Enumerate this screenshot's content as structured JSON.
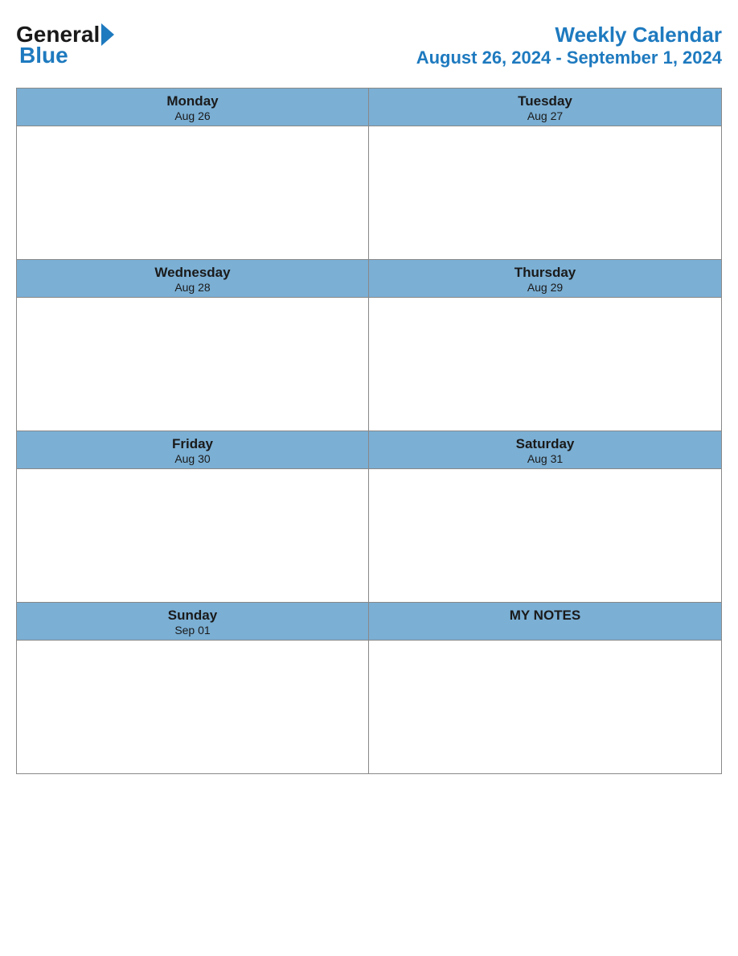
{
  "logo": {
    "general_text": "General",
    "blue_text": "Blue"
  },
  "header": {
    "title": "Weekly Calendar",
    "date_range": "August 26, 2024 - September 1, 2024"
  },
  "days": [
    {
      "name": "Monday",
      "date": "Aug 26"
    },
    {
      "name": "Tuesday",
      "date": "Aug 27"
    },
    {
      "name": "Wednesday",
      "date": "Aug 28"
    },
    {
      "name": "Thursday",
      "date": "Aug 29"
    },
    {
      "name": "Friday",
      "date": "Aug 30"
    },
    {
      "name": "Saturday",
      "date": "Aug 31"
    },
    {
      "name": "Sunday",
      "date": "Sep 01"
    }
  ],
  "notes": {
    "label": "MY NOTES"
  }
}
